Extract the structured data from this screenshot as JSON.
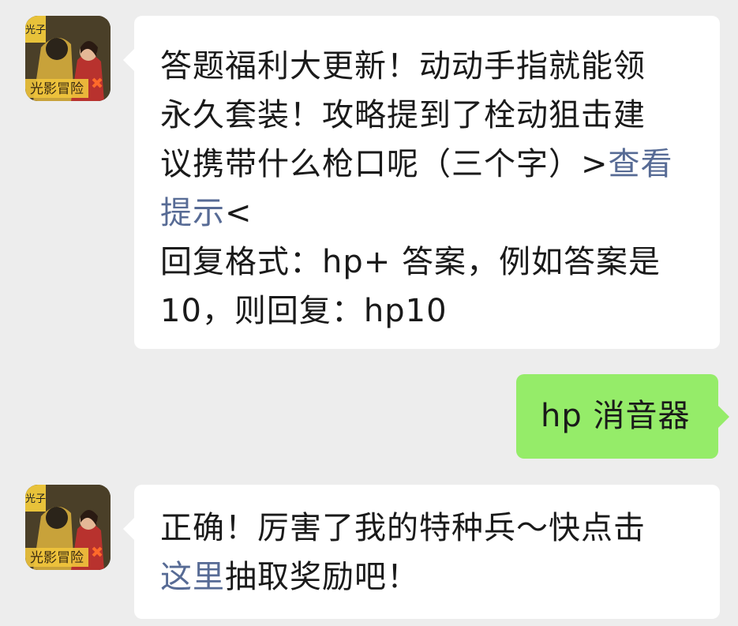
{
  "messages": [
    {
      "sender": "bot",
      "avatar_icon": "game-logo-icon",
      "avatar_text": "光子 光影冒险",
      "lines": [
        [
          "答题福利大更新！动动手指就能领"
        ],
        [
          "永久套装！攻略提到了栓动狙击建"
        ],
        [
          "议携带什么枪口呢（三个字）>",
          "查看"
        ],
        [
          "提示",
          "<"
        ],
        [
          "回复格式：hp+ 答案，例如答案是"
        ],
        [
          "10，则回复：hp10"
        ]
      ]
    },
    {
      "sender": "user",
      "text": "hp 消音器"
    },
    {
      "sender": "bot",
      "avatar_icon": "game-logo-icon",
      "avatar_text": "光子 光影冒险",
      "line1": "正确！厉害了我的特种兵～快点击",
      "line2_link": "这里",
      "line2_rest": "抽取奖励吧！"
    }
  ],
  "colors": {
    "background": "#ededed",
    "bot_bubble": "#ffffff",
    "user_bubble": "#95ec69",
    "link": "#576b95"
  }
}
